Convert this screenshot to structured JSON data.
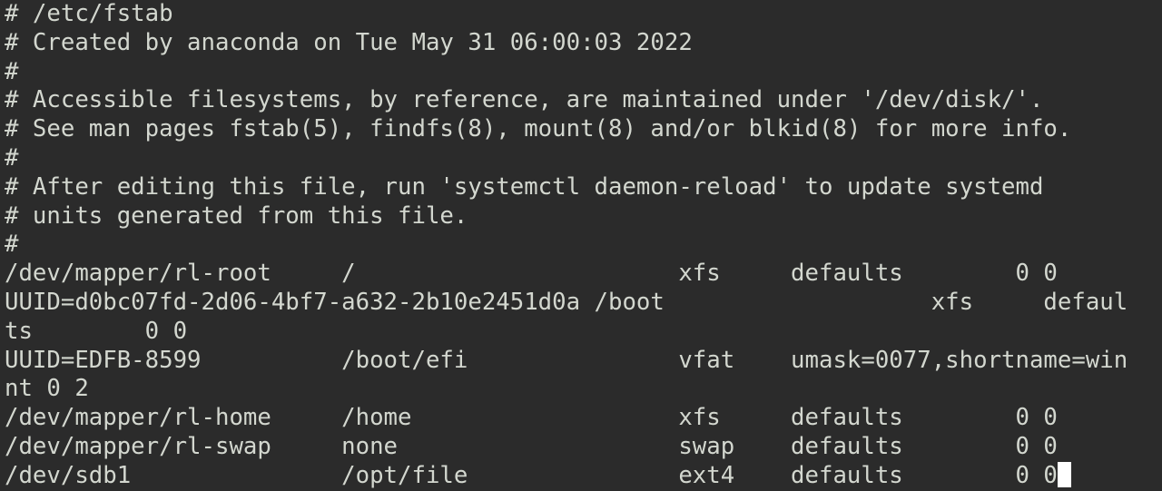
{
  "terminal": {
    "lines": [
      "# /etc/fstab",
      "# Created by anaconda on Tue May 31 06:00:03 2022",
      "#",
      "# Accessible filesystems, by reference, are maintained under '/dev/disk/'.",
      "# See man pages fstab(5), findfs(8), mount(8) and/or blkid(8) for more info.",
      "#",
      "# After editing this file, run 'systemctl daemon-reload' to update systemd",
      "# units generated from this file.",
      "#",
      "/dev/mapper/rl-root     /                       xfs     defaults        0 0",
      "UUID=d0bc07fd-2d06-4bf7-a632-2b10e2451d0a /boot                   xfs     defaul",
      "ts        0 0",
      "UUID=EDFB-8599          /boot/efi               vfat    umask=0077,shortname=win",
      "nt 0 2",
      "/dev/mapper/rl-home     /home                   xfs     defaults        0 0",
      "/dev/mapper/rl-swap     none                    swap    defaults        0 0",
      "/dev/sdb1               /opt/file               ext4    defaults        0 0"
    ]
  }
}
